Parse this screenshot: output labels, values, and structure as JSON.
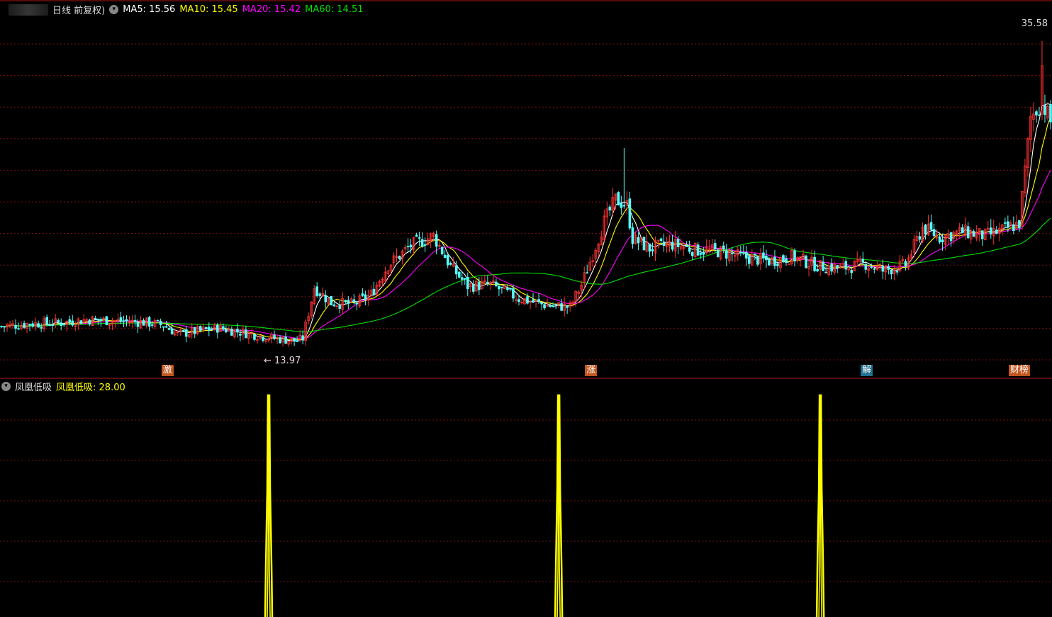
{
  "main_panel": {
    "period_label": "日线 前复权)",
    "ma_legend": [
      {
        "label": "MA5: 15.56",
        "color": "#ffffff"
      },
      {
        "label": "MA10: 15.45",
        "color": "#ffff00"
      },
      {
        "label": "MA20: 15.42",
        "color": "#ff00ff"
      },
      {
        "label": "MA60: 14.51",
        "color": "#00e000"
      }
    ],
    "high_label": "35.58",
    "low_label": "← 13.97",
    "events": [
      {
        "label": "激",
        "color": "#c0561f",
        "x_index": 58
      },
      {
        "label": "涨",
        "color": "#c0561f",
        "x_index": 207
      },
      {
        "label": "解",
        "color": "#1f6f8f",
        "x_index": 304
      },
      {
        "label": "财榜",
        "color": "#c0561f",
        "x_index": 356
      }
    ]
  },
  "sub_panel": {
    "indicator_name": "凤凰低吸",
    "indicator_label": "凤凰低吸: 28.00",
    "label_color": "#ffff00"
  },
  "colors": {
    "up": "#ff3232",
    "down": "#54ffff",
    "grid": "#7a1010",
    "border": "#b01818"
  },
  "chart_data": [
    {
      "type": "candlestick",
      "title": "日线 前复权",
      "xlabel": "",
      "ylabel": "",
      "ylim": [
        12.5,
        37.5
      ],
      "bars_count": 370,
      "visible_extremes": {
        "high": 35.58,
        "low": 13.97
      },
      "close_anchors": [
        [
          0,
          15.1
        ],
        [
          10,
          15.3
        ],
        [
          20,
          15.35
        ],
        [
          30,
          15.6
        ],
        [
          40,
          15.5
        ],
        [
          50,
          15.4
        ],
        [
          57,
          15.2
        ],
        [
          62,
          14.55
        ],
        [
          70,
          14.8
        ],
        [
          76,
          15.0
        ],
        [
          84,
          14.7
        ],
        [
          94,
          14.3
        ],
        [
          104,
          14.05
        ],
        [
          106,
          14.25
        ],
        [
          110,
          17.9
        ],
        [
          116,
          16.8
        ],
        [
          124,
          16.7
        ],
        [
          130,
          17.4
        ],
        [
          136,
          19.5
        ],
        [
          144,
          20.9
        ],
        [
          152,
          21.6
        ],
        [
          158,
          19.4
        ],
        [
          164,
          18.0
        ],
        [
          172,
          18.1
        ],
        [
          182,
          17.1
        ],
        [
          192,
          16.6
        ],
        [
          200,
          16.5
        ],
        [
          204,
          18.1
        ],
        [
          208,
          20.3
        ],
        [
          212,
          22.6
        ],
        [
          216,
          24.2
        ],
        [
          220,
          23.8
        ],
        [
          222,
          21.4
        ],
        [
          228,
          20.7
        ],
        [
          236,
          21.0
        ],
        [
          244,
          20.6
        ],
        [
          252,
          20.5
        ],
        [
          260,
          20.1
        ],
        [
          270,
          19.8
        ],
        [
          278,
          20.1
        ],
        [
          288,
          19.4
        ],
        [
          296,
          19.3
        ],
        [
          304,
          19.6
        ],
        [
          310,
          19.1
        ],
        [
          318,
          19.5
        ],
        [
          324,
          22.2
        ],
        [
          330,
          21.5
        ],
        [
          338,
          21.9
        ],
        [
          346,
          21.6
        ],
        [
          352,
          22.0
        ],
        [
          358,
          22.5
        ],
        [
          362,
          30.1
        ],
        [
          366,
          31.2
        ],
        [
          369,
          29.8
        ]
      ],
      "series": [
        {
          "name": "MA5",
          "value": 15.56,
          "color": "#ffffff"
        },
        {
          "name": "MA10",
          "value": 15.45,
          "color": "#ffff00"
        },
        {
          "name": "MA20",
          "value": 15.42,
          "color": "#ff00ff"
        },
        {
          "name": "MA60",
          "value": 14.51,
          "color": "#00e000"
        }
      ]
    },
    {
      "type": "bar",
      "title": "凤凰低吸",
      "series": [
        {
          "name": "凤凰低吸",
          "current_value": 28.0,
          "color": "#ffff00"
        }
      ],
      "signals": [
        {
          "x_index": 94,
          "value": 28.0
        },
        {
          "x_index": 196,
          "value": 28.0
        },
        {
          "x_index": 288,
          "value": 28.0
        }
      ],
      "ylim": [
        0,
        28
      ]
    }
  ]
}
